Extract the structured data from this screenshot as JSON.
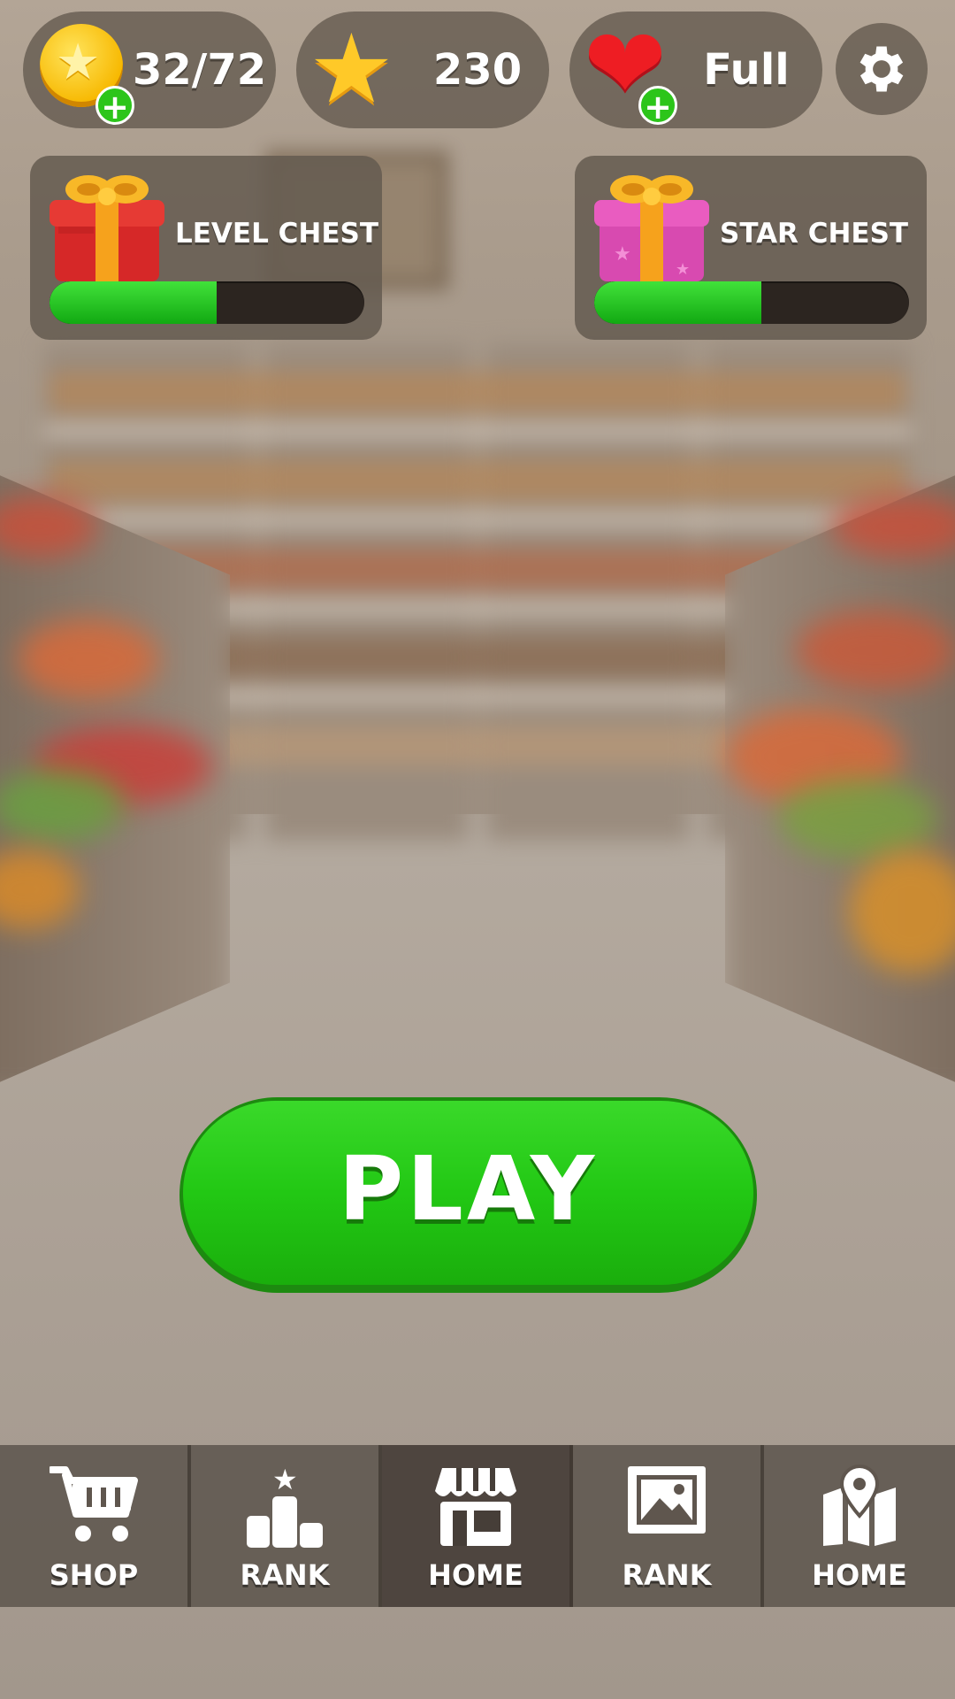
{
  "top_bar": {
    "coins": "32/72",
    "stars": "230",
    "lives": "Full"
  },
  "chests": [
    {
      "label": "LEVEL CHEST",
      "progress": 0.53
    },
    {
      "label": "STAR CHEST",
      "progress": 0.53
    }
  ],
  "play_button": {
    "label": "PLAY"
  },
  "nav": {
    "items": [
      {
        "label": "SHOP",
        "icon": "cart-icon"
      },
      {
        "label": "RANK",
        "icon": "podium-icon"
      },
      {
        "label": "HOME",
        "icon": "store-icon",
        "active": true
      },
      {
        "label": "RANK",
        "icon": "picture-stamp-icon"
      },
      {
        "label": "HOME",
        "icon": "map-pin-icon"
      }
    ]
  },
  "colors": {
    "play_green": "#22c814",
    "progress_green": "#1fc21a",
    "coin_gold": "#f7b800",
    "heart_red": "#ee1d23",
    "level_gift": "#d62828",
    "star_gift": "#e04fb8"
  }
}
